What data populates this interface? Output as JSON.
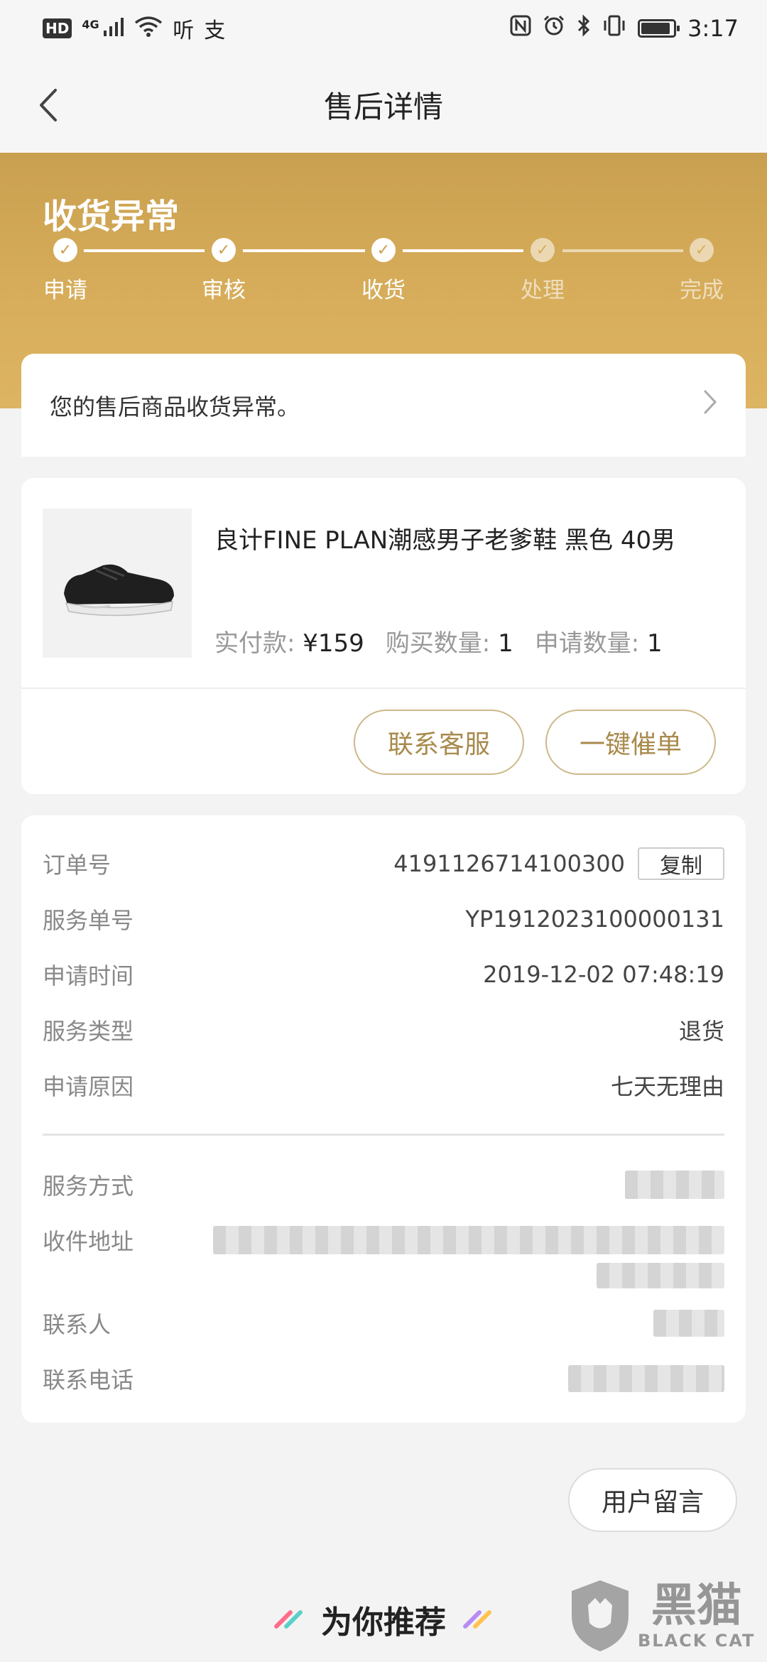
{
  "status_bar": {
    "left_icons": [
      "hd-icon",
      "signal-4g-icon",
      "wifi-icon",
      "ting-app-icon",
      "alipay-app-icon"
    ],
    "hd": "HD",
    "network": "4G",
    "time": "3:17"
  },
  "nav": {
    "title": "售后详情"
  },
  "after_sale": {
    "status_title": "收货异常",
    "steps": [
      {
        "label": "申请",
        "done": true
      },
      {
        "label": "审核",
        "done": true
      },
      {
        "label": "收货",
        "done": true
      },
      {
        "label": "处理",
        "done": false
      },
      {
        "label": "完成",
        "done": false
      }
    ],
    "notice": "您的售后商品收货异常。"
  },
  "product": {
    "name": "良计FINE PLAN潮感男子老爹鞋 黑色 40男",
    "paid_label": "实付款:",
    "paid_value": "¥159",
    "buy_qty_label": "购买数量:",
    "buy_qty_value": "1",
    "apply_qty_label": "申请数量:",
    "apply_qty_value": "1",
    "contact_btn": "联系客服",
    "urge_btn": "一键催单"
  },
  "details": {
    "order_no_label": "订单号",
    "order_no": "4191126714100300",
    "copy_btn": "复制",
    "service_no_label": "服务单号",
    "service_no": "YP1912023100000131",
    "apply_time_label": "申请时间",
    "apply_time": "2019-12-02 07:48:19",
    "service_type_label": "服务类型",
    "service_type": "退货",
    "reason_label": "申请原因",
    "reason": "七天无理由",
    "service_method_label": "服务方式",
    "address_label": "收件地址",
    "contact_label": "联系人",
    "phone_label": "联系电话"
  },
  "message_btn": "用户留言",
  "recommend_title": "为你推荐",
  "watermark": {
    "cn": "黑猫",
    "en": "BLACK CAT"
  },
  "colors": {
    "gold": "#c9a04f",
    "accent_text": "#a88a4c"
  }
}
